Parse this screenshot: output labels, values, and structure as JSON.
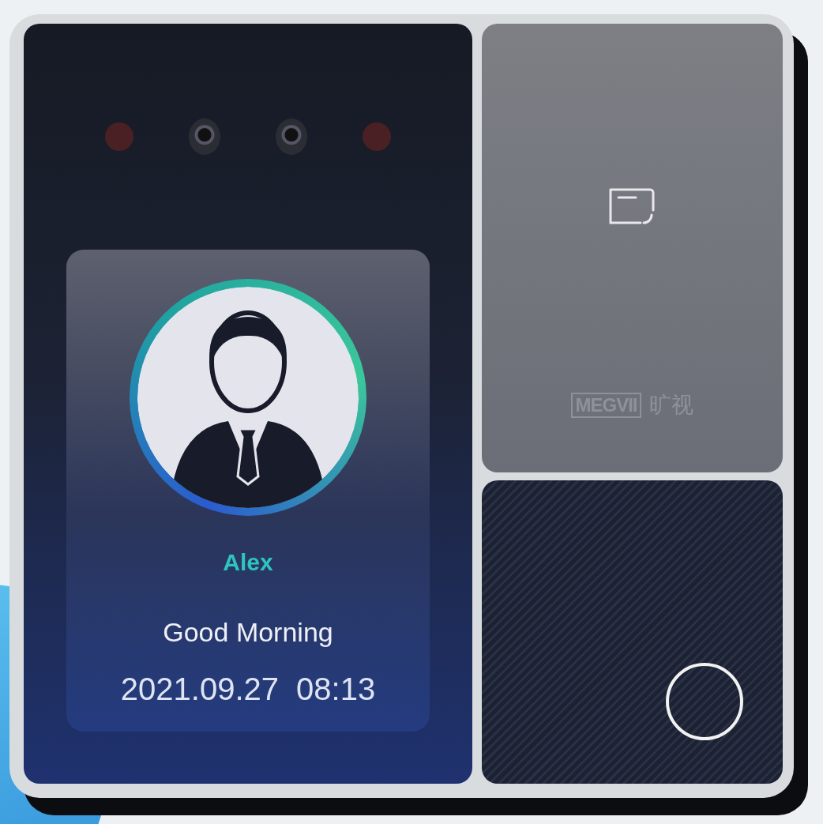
{
  "screen": {
    "name": "Alex",
    "greeting": "Good Morning",
    "date": "2021.09.27",
    "time": "08:13"
  },
  "card_reader": {
    "brand": "MEGVII",
    "brand_chinese": "旷视"
  }
}
